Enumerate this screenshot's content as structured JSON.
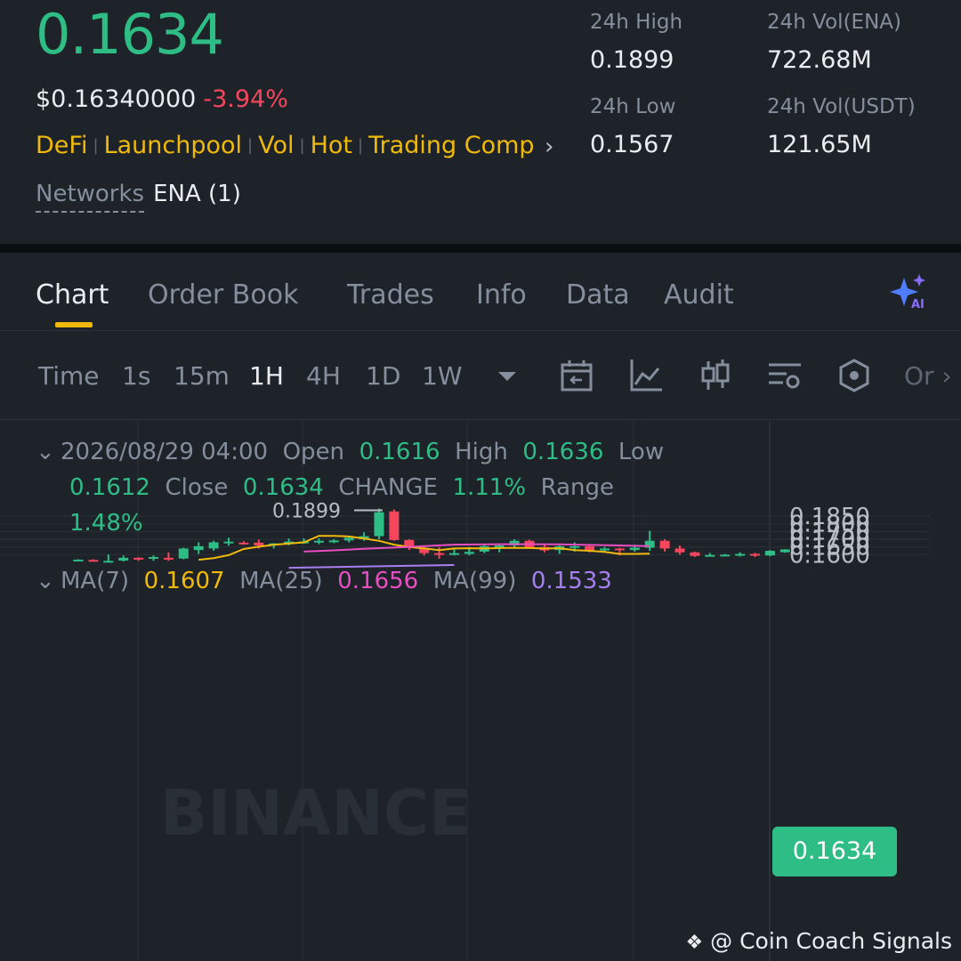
{
  "header": {
    "last_price": "0.1634",
    "usd_price": "$0.16340000",
    "change_pct": "-3.94%",
    "tags": [
      "DeFi",
      "Launchpool",
      "Vol",
      "Hot",
      "Trading Comp"
    ],
    "networks_label": "Networks",
    "networks_value": "ENA (1)",
    "stats": {
      "high_label": "24h High",
      "high_value": "0.1899",
      "low_label": "24h Low",
      "low_value": "0.1567",
      "vol_ena_label": "24h Vol(ENA)",
      "vol_ena_value": "722.68M",
      "vol_usdt_label": "24h Vol(USDT)",
      "vol_usdt_value": "121.65M"
    }
  },
  "tabs": [
    "Chart",
    "Order Book",
    "Trades",
    "Info",
    "Data",
    "Audit"
  ],
  "active_tab": "Chart",
  "toolbar": {
    "timeframes": [
      "Time",
      "1s",
      "15m",
      "1H",
      "4H",
      "1D",
      "1W"
    ],
    "active_timeframe": "1H",
    "more_label": "Or",
    "icons": [
      "chevron-down-icon",
      "calendar-icon",
      "line-chart-icon",
      "candlestick-icon",
      "settings-layers-icon",
      "hexagon-icon"
    ]
  },
  "legend": {
    "datetime": "2026/08/29 04:00",
    "open_label": "Open",
    "open": "0.1616",
    "high_label": "High",
    "high": "0.1636",
    "low_label": "Low",
    "low": "0.1612",
    "close_label": "Close",
    "close": "0.1634",
    "change_label": "CHANGE",
    "change": "1.11%",
    "range_label": "Range",
    "range": "1.48%",
    "ma7_label": "MA(7)",
    "ma7": "0.1607",
    "ma25_label": "MA(25)",
    "ma25": "0.1656",
    "ma99_label": "MA(99)",
    "ma99": "0.1533"
  },
  "chart_labels": {
    "high_marker": "0.1899",
    "current_price": "0.1634",
    "watermark": "BINANCE",
    "credit": "@ Coin Coach Signals"
  },
  "colors": {
    "up": "#2ebd85",
    "down": "#f6465d",
    "accent": "#f0b90b",
    "ma7": "#f0b90b",
    "ma25": "#e84dc1",
    "ma99": "#a77ff0"
  },
  "chart_data": {
    "type": "candlestick",
    "interval": "1H",
    "yticks": [
      "0.1850",
      "0.1800",
      "0.1750",
      "0.1700",
      "0.1650",
      "0.1600"
    ],
    "ylim": [
      0.1565,
      0.1875
    ],
    "candles": [
      {
        "o": 0.1563,
        "h": 0.157,
        "l": 0.156,
        "c": 0.1568
      },
      {
        "o": 0.1566,
        "h": 0.157,
        "l": 0.1558,
        "c": 0.1562
      },
      {
        "o": 0.1556,
        "h": 0.1602,
        "l": 0.155,
        "c": 0.156
      },
      {
        "o": 0.1562,
        "h": 0.1595,
        "l": 0.1556,
        "c": 0.158
      },
      {
        "o": 0.158,
        "h": 0.1583,
        "l": 0.156,
        "c": 0.1572
      },
      {
        "o": 0.1575,
        "h": 0.1595,
        "l": 0.156,
        "c": 0.1585
      },
      {
        "o": 0.158,
        "h": 0.1615,
        "l": 0.156,
        "c": 0.1572
      },
      {
        "o": 0.1575,
        "h": 0.1645,
        "l": 0.157,
        "c": 0.164
      },
      {
        "o": 0.163,
        "h": 0.168,
        "l": 0.1605,
        "c": 0.1655
      },
      {
        "o": 0.164,
        "h": 0.169,
        "l": 0.1625,
        "c": 0.168
      },
      {
        "o": 0.1675,
        "h": 0.171,
        "l": 0.1658,
        "c": 0.1685
      },
      {
        "o": 0.1678,
        "h": 0.1688,
        "l": 0.1665,
        "c": 0.167
      },
      {
        "o": 0.1678,
        "h": 0.1698,
        "l": 0.164,
        "c": 0.166
      },
      {
        "o": 0.166,
        "h": 0.1675,
        "l": 0.164,
        "c": 0.1673
      },
      {
        "o": 0.167,
        "h": 0.1705,
        "l": 0.166,
        "c": 0.1685
      },
      {
        "o": 0.168,
        "h": 0.1706,
        "l": 0.167,
        "c": 0.1685
      },
      {
        "o": 0.1682,
        "h": 0.1706,
        "l": 0.1668,
        "c": 0.169
      },
      {
        "o": 0.1688,
        "h": 0.17,
        "l": 0.1675,
        "c": 0.1692
      },
      {
        "o": 0.1692,
        "h": 0.1715,
        "l": 0.168,
        "c": 0.171
      },
      {
        "o": 0.17,
        "h": 0.1745,
        "l": 0.169,
        "c": 0.172
      },
      {
        "o": 0.172,
        "h": 0.1899,
        "l": 0.17,
        "c": 0.1875
      },
      {
        "o": 0.188,
        "h": 0.1893,
        "l": 0.169,
        "c": 0.1695
      },
      {
        "o": 0.1695,
        "h": 0.17,
        "l": 0.163,
        "c": 0.1645
      },
      {
        "o": 0.1645,
        "h": 0.166,
        "l": 0.1595,
        "c": 0.161
      },
      {
        "o": 0.161,
        "h": 0.165,
        "l": 0.1575,
        "c": 0.1605
      },
      {
        "o": 0.1605,
        "h": 0.1635,
        "l": 0.1595,
        "c": 0.161
      },
      {
        "o": 0.1605,
        "h": 0.165,
        "l": 0.1595,
        "c": 0.1618
      },
      {
        "o": 0.162,
        "h": 0.1665,
        "l": 0.161,
        "c": 0.1655
      },
      {
        "o": 0.165,
        "h": 0.167,
        "l": 0.1615,
        "c": 0.166
      },
      {
        "o": 0.166,
        "h": 0.17,
        "l": 0.1645,
        "c": 0.169
      },
      {
        "o": 0.169,
        "h": 0.1697,
        "l": 0.164,
        "c": 0.1645
      },
      {
        "o": 0.165,
        "h": 0.167,
        "l": 0.1615,
        "c": 0.1628
      },
      {
        "o": 0.163,
        "h": 0.166,
        "l": 0.1605,
        "c": 0.1655
      },
      {
        "o": 0.165,
        "h": 0.168,
        "l": 0.162,
        "c": 0.1655
      },
      {
        "o": 0.1655,
        "h": 0.166,
        "l": 0.1615,
        "c": 0.1628
      },
      {
        "o": 0.1628,
        "h": 0.165,
        "l": 0.1615,
        "c": 0.164
      },
      {
        "o": 0.164,
        "h": 0.1645,
        "l": 0.1595,
        "c": 0.163
      },
      {
        "o": 0.163,
        "h": 0.1665,
        "l": 0.162,
        "c": 0.1645
      },
      {
        "o": 0.1645,
        "h": 0.1755,
        "l": 0.1625,
        "c": 0.169
      },
      {
        "o": 0.169,
        "h": 0.17,
        "l": 0.162,
        "c": 0.164
      },
      {
        "o": 0.164,
        "h": 0.166,
        "l": 0.16,
        "c": 0.1615
      },
      {
        "o": 0.1615,
        "h": 0.162,
        "l": 0.1585,
        "c": 0.1592
      },
      {
        "o": 0.1595,
        "h": 0.161,
        "l": 0.159,
        "c": 0.1598
      },
      {
        "o": 0.1597,
        "h": 0.1605,
        "l": 0.1592,
        "c": 0.16
      },
      {
        "o": 0.16,
        "h": 0.1615,
        "l": 0.1588,
        "c": 0.1605
      },
      {
        "o": 0.1605,
        "h": 0.1612,
        "l": 0.1585,
        "c": 0.1595
      },
      {
        "o": 0.1595,
        "h": 0.163,
        "l": 0.159,
        "c": 0.1625
      },
      {
        "o": 0.1616,
        "h": 0.1636,
        "l": 0.1612,
        "c": 0.1634
      }
    ],
    "ma7": [
      null,
      null,
      null,
      null,
      null,
      null,
      0.1567,
      0.1578,
      0.1597,
      0.1617,
      0.1637,
      0.1652,
      0.1664,
      0.1672,
      0.168,
      0.1712,
      0.1722,
      0.1722,
      0.1718,
      0.1705,
      0.169,
      0.1675,
      0.1665,
      0.165,
      0.164,
      0.163,
      0.164,
      0.164,
      0.1642,
      0.164,
      0.1643,
      0.1645,
      0.1643,
      0.164,
      0.164,
      0.1642,
      0.163,
      0.1625,
      0.1618,
      0.1612,
      0.1605,
      0.1605,
      0.1607
    ],
    "ma25": [
      null,
      null,
      null,
      null,
      null,
      null,
      null,
      null,
      null,
      null,
      null,
      null,
      null,
      null,
      null,
      null,
      null,
      null,
      null,
      null,
      0.162,
      0.1628,
      0.1638,
      0.1646,
      0.1655,
      0.1665,
      0.1668,
      0.1668,
      0.1667,
      0.1663,
      0.166,
      0.1656
    ],
    "ma99": [
      null,
      null,
      null,
      null,
      null,
      null,
      null,
      null,
      null,
      null,
      null,
      null,
      null,
      null,
      null,
      null,
      null,
      null,
      null,
      null,
      null,
      null,
      null,
      null,
      null,
      0.1515,
      0.1525,
      0.1533
    ]
  }
}
